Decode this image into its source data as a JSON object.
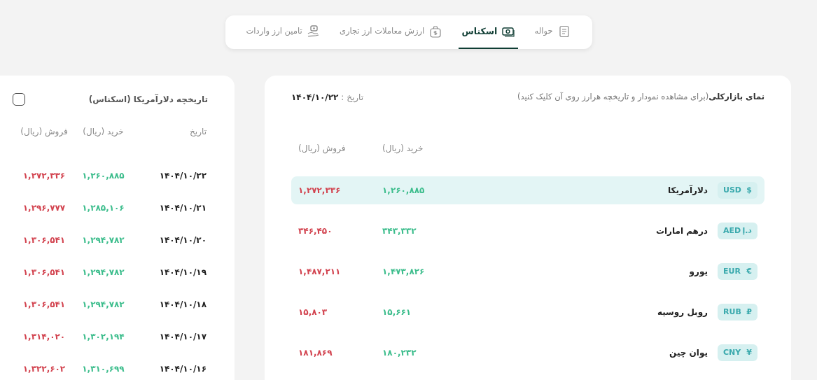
{
  "tabs": [
    {
      "label": "حواله",
      "selected": false
    },
    {
      "label": "اسکناس",
      "selected": true
    },
    {
      "label": "ارزش معاملات ارز تجاری",
      "selected": false
    },
    {
      "label": "تامین ارز واردات",
      "selected": false
    }
  ],
  "market": {
    "title": "**نمای بازارکلی**(برای مشاهده نمودار و تاریخچه هرارز روی آن کلیک کنید)",
    "date_label": "تاریخ :",
    "date": "۱۴۰۴/۱۰/۲۲",
    "columns": [
      "خرید (ریال)",
      "فروش (ریال)"
    ],
    "rows": [
      {
        "symbol": "$",
        "code": "USD",
        "name": "دلارآمریکا",
        "buy": "۱,۲۶۰,۸۸۵",
        "sell": "۱,۲۷۲,۳۳۶",
        "selected": true
      },
      {
        "symbol": "د.إ",
        "code": "AED",
        "name": "درهم امارات",
        "buy": "۳۴۳,۳۳۲",
        "sell": "۳۴۶,۴۵۰",
        "selected": false
      },
      {
        "symbol": "€",
        "code": "EUR",
        "name": "یورو",
        "buy": "۱,۴۷۳,۸۲۶",
        "sell": "۱,۴۸۷,۲۱۱",
        "selected": false
      },
      {
        "symbol": "₽",
        "code": "RUB",
        "name": "روبل روسیه",
        "buy": "۱۵,۶۶۱",
        "sell": "۱۵,۸۰۳",
        "selected": false
      },
      {
        "symbol": "¥",
        "code": "CNY",
        "name": "یوان چین",
        "buy": "۱۸۰,۲۳۲",
        "sell": "۱۸۱,۸۶۹",
        "selected": false
      }
    ]
  },
  "history": {
    "title": "تاریخچه دلارآمریکا (اسکناس)",
    "checkbox": {
      "checked": false
    },
    "columns": [
      "تاریخ",
      "خرید (ریال)",
      "فروش (ریال)"
    ],
    "rows": [
      {
        "date": "۱۴۰۴/۱۰/۲۲",
        "buy": "۱,۲۶۰,۸۸۵",
        "sell": "۱,۲۷۲,۳۳۶"
      },
      {
        "date": "۱۴۰۴/۱۰/۲۱",
        "buy": "۱,۲۸۵,۱۰۶",
        "sell": "۱,۲۹۶,۷۷۷"
      },
      {
        "date": "۱۴۰۴/۱۰/۲۰",
        "buy": "۱,۲۹۴,۷۸۲",
        "sell": "۱,۳۰۶,۵۴۱"
      },
      {
        "date": "۱۴۰۴/۱۰/۱۹",
        "buy": "۱,۲۹۴,۷۸۲",
        "sell": "۱,۳۰۶,۵۴۱"
      },
      {
        "date": "۱۴۰۴/۱۰/۱۸",
        "buy": "۱,۲۹۴,۷۸۲",
        "sell": "۱,۳۰۶,۵۴۱"
      },
      {
        "date": "۱۴۰۴/۱۰/۱۷",
        "buy": "۱,۳۰۲,۱۹۴",
        "sell": "۱,۳۱۴,۰۲۰"
      },
      {
        "date": "۱۴۰۴/۱۰/۱۶",
        "buy": "۱,۳۱۰,۶۹۹",
        "sell": "۱,۳۲۲,۶۰۲"
      }
    ]
  }
}
